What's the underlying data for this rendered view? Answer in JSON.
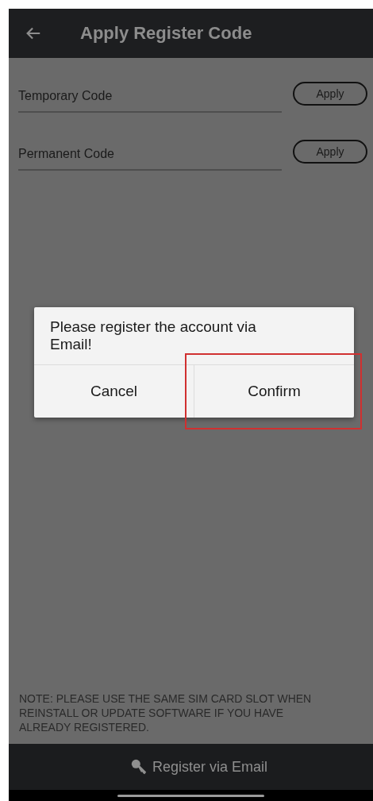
{
  "header": {
    "title": "Apply Register Code"
  },
  "codes": [
    {
      "label": "Temporary Code",
      "button": "Apply"
    },
    {
      "label": "Permanent Code",
      "button": "Apply"
    }
  ],
  "dialog": {
    "message": "Please register the account via Email!",
    "buttons": [
      {
        "label": "Cancel",
        "highlighted": false
      },
      {
        "label": "Confirm",
        "highlighted": true
      }
    ]
  },
  "note": "NOTE: PLEASE USE THE SAME SIM CARD SLOT WHEN REINSTALL OR UPDATE SOFTWARE IF YOU HAVE ALREADY REGISTERED.",
  "bottom_action": {
    "label": "Register via Email"
  }
}
